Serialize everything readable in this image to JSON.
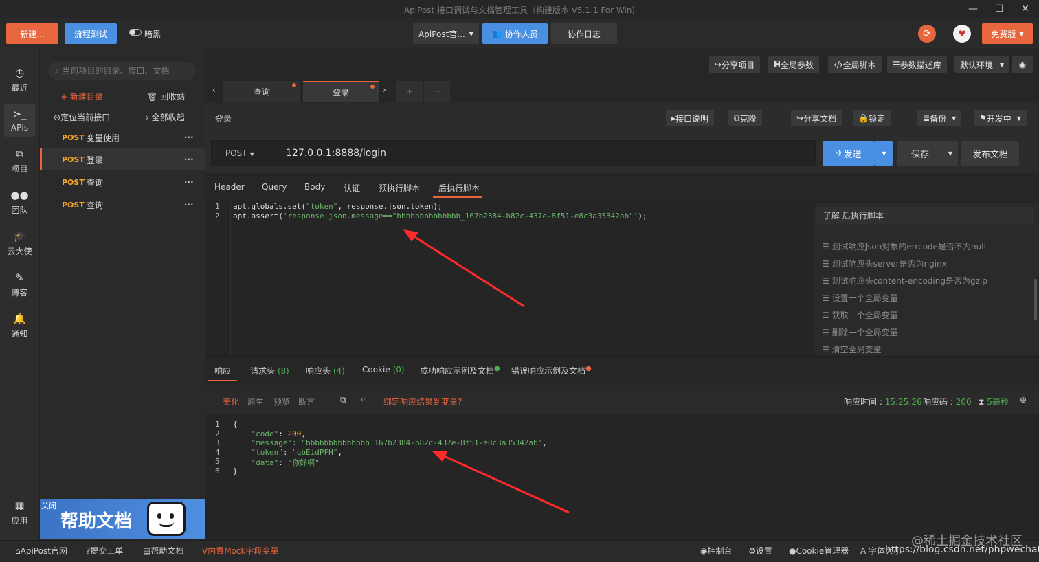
{
  "window": {
    "title": "ApiPost 接口调试与文档管理工具（构建版本 V5.1.1 For Win)",
    "min": "—",
    "max": "☐",
    "close": "✕"
  },
  "topbar": {
    "new_label": "新建...",
    "flow_test_label": "流程测试",
    "dark_label": "暗黑",
    "project_label": "ApiPost官...",
    "collaborators_label": "协作人员",
    "log_label": "协作日志",
    "plan_label": "免费版"
  },
  "leftnav": {
    "items": [
      {
        "icon": "◷",
        "label": "最近"
      },
      {
        "icon": "≻_",
        "label": "APIs"
      },
      {
        "icon": "⧉",
        "label": "项目"
      },
      {
        "icon": "●●",
        "label": "团队"
      },
      {
        "icon": "🎓",
        "label": "云大使"
      },
      {
        "icon": "✎",
        "label": "博客"
      },
      {
        "icon": "🔔",
        "label": "通知"
      },
      {
        "icon": "▦",
        "label": "应用"
      }
    ]
  },
  "sidebar": {
    "search_placeholder": "当前项目的目录、接口、文档",
    "new_folder": "新建目录",
    "recycle": "回收站",
    "locate": "定位当前接口",
    "collapse": "全部收起",
    "apis": [
      {
        "method": "POST",
        "name": "变量使用"
      },
      {
        "method": "POST",
        "name": "登录"
      },
      {
        "method": "POST",
        "name": "查询"
      },
      {
        "method": "POST",
        "name": "查询"
      }
    ],
    "banner": {
      "close": "关闭",
      "title": "帮助文档"
    }
  },
  "toolbar": {
    "share_project": "分享项目",
    "global_params": "全局参数",
    "global_script": "全局脚本",
    "param_lib": "参数描述库",
    "env": "默认环境"
  },
  "tabs": [
    {
      "label": "查询"
    },
    {
      "label": "登录"
    }
  ],
  "request": {
    "breadcrumb": "登录",
    "doc_btn": "接口说明",
    "clone_btn": "克隆",
    "share_doc_btn": "分享文档",
    "lock_btn": "锁定",
    "backup_btn": "备份",
    "status_btn": "开发中",
    "method": "POST",
    "url": "127.0.0.1:8888/login",
    "send": "发送",
    "save": "保存",
    "publish": "发布文档",
    "subtabs": [
      "Header",
      "Query",
      "Body",
      "认证",
      "预执行脚本",
      "后执行脚本"
    ]
  },
  "editor": {
    "line1_a": "apt.globals.set(",
    "line1_b": "\"token\"",
    "line1_c": ", response.json.token);",
    "line2_a": "apt.assert(",
    "line2_b": "'response.json.message==\"bbbbbbbbbbbbbb_167b2384-b82c-437e-8f51-e8c3a35342ab\"'",
    "line2_c": ");"
  },
  "snippets": {
    "header": "了解 后执行脚本",
    "items": [
      "测试响应Json对象的errcode是否不为null",
      "测试响应头server是否为nginx",
      "测试响应头content-encoding是否为gzip",
      "设置一个全局变量",
      "获取一个全局变量",
      "删除一个全局变量",
      "清空全局变量"
    ]
  },
  "response": {
    "tabs": [
      "响应",
      "请求头",
      "响应头",
      "Cookie",
      "成功响应示例及文档",
      "错误响应示例及文档"
    ],
    "req_count": "(8)",
    "resp_count": "(4)",
    "cookie_count": "(0)",
    "views": [
      "美化",
      "原生",
      "预览",
      "断言"
    ],
    "bind_var": "绑定响应结果到变量?",
    "time_label": "响应时间 : ",
    "time_value": "15:25:26",
    "code_label": "响应码 : ",
    "code_value": "200",
    "ms_value": "5毫秒",
    "json_code": "200",
    "json_message": "\"bbbbbbbbbbbbbb_167b2384-b82c-437e-8f51-e8c3a35342ab\"",
    "json_token": "\"qbEidPFH\"",
    "json_data": "\"你好啊\""
  },
  "statusbar": {
    "site": "ApiPost官网",
    "ticket": "提交工单",
    "help": "帮助文档",
    "mock": "内置Mock字段变量",
    "console": "控制台",
    "settings": "设置",
    "cookie": "Cookie管理器",
    "font": "字体大小",
    "watermark1": "@稀土掘金技术社区",
    "watermark2": "https://blog.csdn.net/phpwechat"
  }
}
